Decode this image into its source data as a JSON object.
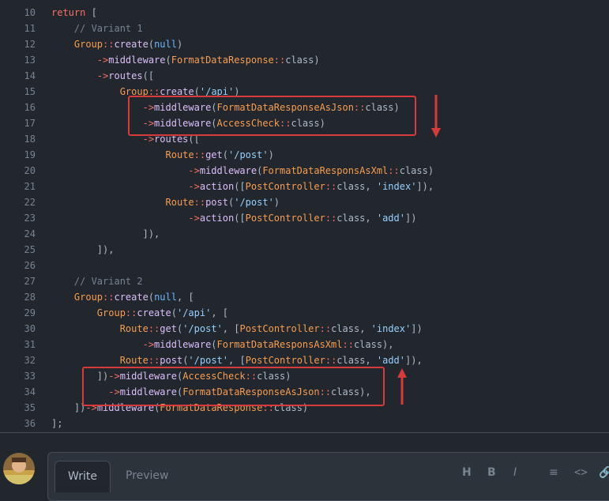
{
  "code": {
    "lines": [
      {
        "n": "10",
        "tokens": [
          {
            "t": "return",
            "c": "kw"
          },
          {
            "t": " [",
            "c": "plain"
          }
        ]
      },
      {
        "n": "11",
        "tokens": [
          {
            "t": "    // Variant 1",
            "c": "cm"
          }
        ]
      },
      {
        "n": "12",
        "tokens": [
          {
            "t": "    ",
            "c": "plain"
          },
          {
            "t": "Group",
            "c": "cls"
          },
          {
            "t": "::",
            "c": "kw"
          },
          {
            "t": "create",
            "c": "fn"
          },
          {
            "t": "(",
            "c": "plain"
          },
          {
            "t": "null",
            "c": "nl"
          },
          {
            "t": ")",
            "c": "plain"
          }
        ]
      },
      {
        "n": "13",
        "tokens": [
          {
            "t": "        ",
            "c": "plain"
          },
          {
            "t": "->",
            "c": "kw"
          },
          {
            "t": "middleware",
            "c": "fn"
          },
          {
            "t": "(",
            "c": "plain"
          },
          {
            "t": "FormatDataResponse",
            "c": "cls"
          },
          {
            "t": "::",
            "c": "kw"
          },
          {
            "t": "class)",
            "c": "plain"
          }
        ]
      },
      {
        "n": "14",
        "tokens": [
          {
            "t": "        ",
            "c": "plain"
          },
          {
            "t": "->",
            "c": "kw"
          },
          {
            "t": "routes",
            "c": "fn"
          },
          {
            "t": "([",
            "c": "plain"
          }
        ]
      },
      {
        "n": "15",
        "tokens": [
          {
            "t": "            ",
            "c": "plain"
          },
          {
            "t": "Group",
            "c": "cls"
          },
          {
            "t": "::",
            "c": "kw"
          },
          {
            "t": "create",
            "c": "fn"
          },
          {
            "t": "(",
            "c": "plain"
          },
          {
            "t": "'/api'",
            "c": "str"
          },
          {
            "t": ")",
            "c": "plain"
          }
        ]
      },
      {
        "n": "16",
        "tokens": [
          {
            "t": "                ",
            "c": "plain"
          },
          {
            "t": "->",
            "c": "kw"
          },
          {
            "t": "middleware",
            "c": "fn"
          },
          {
            "t": "(",
            "c": "plain"
          },
          {
            "t": "FormatDataResponseAsJson",
            "c": "cls"
          },
          {
            "t": "::",
            "c": "kw"
          },
          {
            "t": "class)",
            "c": "plain"
          }
        ]
      },
      {
        "n": "17",
        "tokens": [
          {
            "t": "                ",
            "c": "plain"
          },
          {
            "t": "->",
            "c": "kw"
          },
          {
            "t": "middleware",
            "c": "fn"
          },
          {
            "t": "(",
            "c": "plain"
          },
          {
            "t": "AccessCheck",
            "c": "cls"
          },
          {
            "t": "::",
            "c": "kw"
          },
          {
            "t": "class)",
            "c": "plain"
          }
        ]
      },
      {
        "n": "18",
        "tokens": [
          {
            "t": "                ",
            "c": "plain"
          },
          {
            "t": "->",
            "c": "kw"
          },
          {
            "t": "routes",
            "c": "fn"
          },
          {
            "t": "([",
            "c": "plain"
          }
        ]
      },
      {
        "n": "19",
        "tokens": [
          {
            "t": "                    ",
            "c": "plain"
          },
          {
            "t": "Route",
            "c": "cls"
          },
          {
            "t": "::",
            "c": "kw"
          },
          {
            "t": "get",
            "c": "fn"
          },
          {
            "t": "(",
            "c": "plain"
          },
          {
            "t": "'/post'",
            "c": "str"
          },
          {
            "t": ")",
            "c": "plain"
          }
        ]
      },
      {
        "n": "20",
        "tokens": [
          {
            "t": "                        ",
            "c": "plain"
          },
          {
            "t": "->",
            "c": "kw"
          },
          {
            "t": "middleware",
            "c": "fn"
          },
          {
            "t": "(",
            "c": "plain"
          },
          {
            "t": "FormatDataResponsAsXml",
            "c": "cls"
          },
          {
            "t": "::",
            "c": "kw"
          },
          {
            "t": "class)",
            "c": "plain"
          }
        ]
      },
      {
        "n": "21",
        "tokens": [
          {
            "t": "                        ",
            "c": "plain"
          },
          {
            "t": "->",
            "c": "kw"
          },
          {
            "t": "action",
            "c": "fn"
          },
          {
            "t": "([",
            "c": "plain"
          },
          {
            "t": "PostController",
            "c": "cls"
          },
          {
            "t": "::",
            "c": "kw"
          },
          {
            "t": "class, ",
            "c": "plain"
          },
          {
            "t": "'index'",
            "c": "str"
          },
          {
            "t": "]),",
            "c": "plain"
          }
        ]
      },
      {
        "n": "22",
        "tokens": [
          {
            "t": "                    ",
            "c": "plain"
          },
          {
            "t": "Route",
            "c": "cls"
          },
          {
            "t": "::",
            "c": "kw"
          },
          {
            "t": "post",
            "c": "fn"
          },
          {
            "t": "(",
            "c": "plain"
          },
          {
            "t": "'/post'",
            "c": "str"
          },
          {
            "t": ")",
            "c": "plain"
          }
        ]
      },
      {
        "n": "23",
        "tokens": [
          {
            "t": "                        ",
            "c": "plain"
          },
          {
            "t": "->",
            "c": "kw"
          },
          {
            "t": "action",
            "c": "fn"
          },
          {
            "t": "([",
            "c": "plain"
          },
          {
            "t": "PostController",
            "c": "cls"
          },
          {
            "t": "::",
            "c": "kw"
          },
          {
            "t": "class, ",
            "c": "plain"
          },
          {
            "t": "'add'",
            "c": "str"
          },
          {
            "t": "])",
            "c": "plain"
          }
        ]
      },
      {
        "n": "24",
        "tokens": [
          {
            "t": "                ]),",
            "c": "plain"
          }
        ]
      },
      {
        "n": "25",
        "tokens": [
          {
            "t": "        ]),",
            "c": "plain"
          }
        ]
      },
      {
        "n": "26",
        "tokens": []
      },
      {
        "n": "27",
        "tokens": [
          {
            "t": "    // Variant 2",
            "c": "cm"
          }
        ]
      },
      {
        "n": "28",
        "tokens": [
          {
            "t": "    ",
            "c": "plain"
          },
          {
            "t": "Group",
            "c": "cls"
          },
          {
            "t": "::",
            "c": "kw"
          },
          {
            "t": "create",
            "c": "fn"
          },
          {
            "t": "(",
            "c": "plain"
          },
          {
            "t": "null",
            "c": "nl"
          },
          {
            "t": ", [",
            "c": "plain"
          }
        ]
      },
      {
        "n": "29",
        "tokens": [
          {
            "t": "        ",
            "c": "plain"
          },
          {
            "t": "Group",
            "c": "cls"
          },
          {
            "t": "::",
            "c": "kw"
          },
          {
            "t": "create",
            "c": "fn"
          },
          {
            "t": "(",
            "c": "plain"
          },
          {
            "t": "'/api'",
            "c": "str"
          },
          {
            "t": ", [",
            "c": "plain"
          }
        ]
      },
      {
        "n": "30",
        "tokens": [
          {
            "t": "            ",
            "c": "plain"
          },
          {
            "t": "Route",
            "c": "cls"
          },
          {
            "t": "::",
            "c": "kw"
          },
          {
            "t": "get",
            "c": "fn"
          },
          {
            "t": "(",
            "c": "plain"
          },
          {
            "t": "'/post'",
            "c": "str"
          },
          {
            "t": ", [",
            "c": "plain"
          },
          {
            "t": "PostController",
            "c": "cls"
          },
          {
            "t": "::",
            "c": "kw"
          },
          {
            "t": "class, ",
            "c": "plain"
          },
          {
            "t": "'index'",
            "c": "str"
          },
          {
            "t": "])",
            "c": "plain"
          }
        ]
      },
      {
        "n": "31",
        "tokens": [
          {
            "t": "                ",
            "c": "plain"
          },
          {
            "t": "->",
            "c": "kw"
          },
          {
            "t": "middleware",
            "c": "fn"
          },
          {
            "t": "(",
            "c": "plain"
          },
          {
            "t": "FormatDataResponsAsXml",
            "c": "cls"
          },
          {
            "t": "::",
            "c": "kw"
          },
          {
            "t": "class),",
            "c": "plain"
          }
        ]
      },
      {
        "n": "32",
        "tokens": [
          {
            "t": "            ",
            "c": "plain"
          },
          {
            "t": "Route",
            "c": "cls"
          },
          {
            "t": "::",
            "c": "kw"
          },
          {
            "t": "post",
            "c": "fn"
          },
          {
            "t": "(",
            "c": "plain"
          },
          {
            "t": "'/post'",
            "c": "str"
          },
          {
            "t": ", [",
            "c": "plain"
          },
          {
            "t": "PostController",
            "c": "cls"
          },
          {
            "t": "::",
            "c": "kw"
          },
          {
            "t": "class, ",
            "c": "plain"
          },
          {
            "t": "'add'",
            "c": "str"
          },
          {
            "t": "]),",
            "c": "plain"
          }
        ]
      },
      {
        "n": "33",
        "tokens": [
          {
            "t": "        ])",
            "c": "plain"
          },
          {
            "t": "->",
            "c": "kw"
          },
          {
            "t": "middleware",
            "c": "fn"
          },
          {
            "t": "(",
            "c": "plain"
          },
          {
            "t": "AccessCheck",
            "c": "cls"
          },
          {
            "t": "::",
            "c": "kw"
          },
          {
            "t": "class)",
            "c": "plain"
          }
        ]
      },
      {
        "n": "34",
        "tokens": [
          {
            "t": "          ",
            "c": "plain"
          },
          {
            "t": "->",
            "c": "kw"
          },
          {
            "t": "middleware",
            "c": "fn"
          },
          {
            "t": "(",
            "c": "plain"
          },
          {
            "t": "FormatDataResponseAsJson",
            "c": "cls"
          },
          {
            "t": "::",
            "c": "kw"
          },
          {
            "t": "class),",
            "c": "plain"
          }
        ]
      },
      {
        "n": "35",
        "tokens": [
          {
            "t": "    ])",
            "c": "plain"
          },
          {
            "t": "->",
            "c": "kw"
          },
          {
            "t": "middleware",
            "c": "fn"
          },
          {
            "t": "(",
            "c": "plain"
          },
          {
            "t": "FormatDataResponse",
            "c": "cls"
          },
          {
            "t": "::",
            "c": "kw"
          },
          {
            "t": "class)",
            "c": "plain"
          }
        ]
      },
      {
        "n": "36",
        "tokens": [
          {
            "t": "];",
            "c": "plain"
          }
        ]
      }
    ]
  },
  "annotation_color": "#d73a3a",
  "editor": {
    "tabs": [
      {
        "label": "Write",
        "active": true
      },
      {
        "label": "Preview",
        "active": false
      }
    ],
    "toolbar": [
      {
        "icon": "heading-icon",
        "glyph": "H"
      },
      {
        "icon": "bold-icon",
        "glyph": "B"
      },
      {
        "icon": "italic-icon",
        "glyph": "I"
      },
      {
        "icon": "list-icon",
        "glyph": "≡"
      },
      {
        "icon": "code-icon",
        "glyph": "<>"
      },
      {
        "icon": "link-icon",
        "glyph": "🔗"
      }
    ]
  }
}
